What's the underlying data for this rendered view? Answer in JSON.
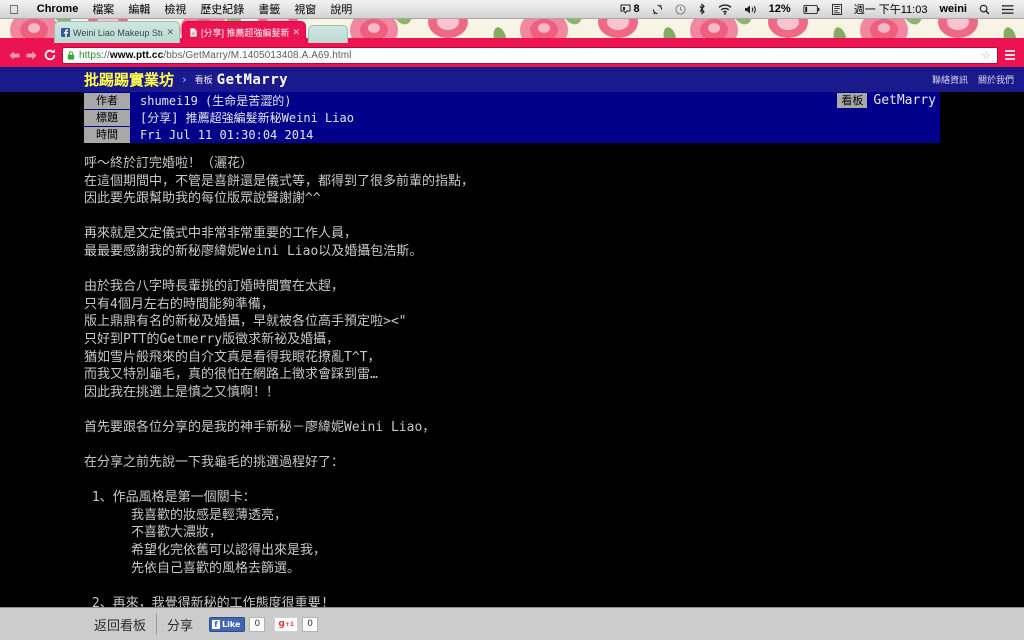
{
  "menubar": {
    "apple_icon": "apple-icon",
    "app_name": "Chrome",
    "items": [
      "檔案",
      "編輯",
      "檢視",
      "歷史紀錄",
      "書籤",
      "視窗",
      "說明"
    ],
    "status": {
      "airplay_label": "8",
      "sync_icon": "sync-arrows-icon",
      "clock_icon": "clock-icon",
      "bluetooth_icon": "bluetooth-icon",
      "wifi_icon": "wifi-icon",
      "volume_icon": "volume-icon",
      "battery_percent": "12%",
      "battery_icon": "battery-icon",
      "input_source_icon": "input-source-icon",
      "datetime": "週一 下午11:03",
      "user": "weini",
      "spotlight_icon": "search-icon",
      "notification_icon": "notification-center-icon"
    }
  },
  "browser": {
    "tabs": [
      {
        "title": "Weini Liao Makeup Studio",
        "favicon": "facebook-icon",
        "active": false
      },
      {
        "title": "[分享] 推薦超強編髮新秘Wei",
        "favicon": "document-icon",
        "active": true
      }
    ],
    "close_glyph": "✕",
    "nav": {
      "back_icon": "back-arrow-icon",
      "forward_icon": "forward-arrow-icon",
      "reload_icon": "reload-icon"
    },
    "omnibox": {
      "lock_icon": "lock-icon",
      "scheme": "https",
      "separator": "://",
      "host": "www.ptt.cc",
      "path": "/bbs/GetMarry/M.1405013408.A.A69.html",
      "full_url": "https://www.ptt.cc/bbs/GetMarry/M.1405013408.A.A69.html"
    },
    "bookmark_icon": "star-icon",
    "menu_icon": "hamburger-menu-icon",
    "window_resize_icon": "fullscreen-icon"
  },
  "ptt": {
    "header": {
      "brand": "批踢踢實業坊",
      "separator": "›",
      "board_label": "看板",
      "board_name": "GetMarry",
      "links": [
        "聯絡資訊",
        "關於我們"
      ]
    },
    "meta": {
      "rows": [
        {
          "label": "作者",
          "value": "shumei19 (生命是苦澀的)"
        },
        {
          "label": "標題",
          "value": "[分享] 推薦超強編髮新秘Weini Liao"
        },
        {
          "label": "時間",
          "value": "Fri Jul 11 01:30:04 2014"
        }
      ],
      "board_tag_label": "看板",
      "board_tag_value": "GetMarry"
    },
    "content": "呼〜終於訂完婚啦！（灑花）\n在這個期間中，不管是喜餅還是儀式等，都得到了很多前輩的指點，\n因此要先跟幫助我的每位版眾說聲謝謝^^\n\n再來就是文定儀式中非常非常重要的工作人員，\n最最要感謝我的新秘廖緯妮Weini Liao以及婚攝包浩斯。\n\n由於我合八字時長輩挑的訂婚時間實在太趕，\n只有4個月左右的時間能夠準備，\n版上鼎鼎有名的新秘及婚攝，早就被各位高手預定啦><\"\n只好到PTT的Getmerry版徵求新祕及婚攝，\n猶如雪片般飛來的自介文真是看得我眼花撩亂T^T，\n而我又特別龜毛，真的很怕在網路上徵求會踩到雷…\n因此我在挑選上是慎之又慎啊！！\n\n首先要跟各位分享的是我的神手新秘－廖緯妮Weini Liao，\n\n在分享之前先說一下我龜毛的挑選過程好了：\n\n 1、作品風格是第一個關卡：\n      我喜歡的妝感是輕薄透亮，\n      不喜歡大濃妝，\n      希望化完依舊可以認得出來是我，\n      先依自己喜歡的風格去篩選。\n\n 2、再來，我覺得新秘的工作態度很重要!",
    "bottom": {
      "back_label": "返回看板",
      "share_label": "分享",
      "fb_like_label": "Like",
      "fb_like_count": "0",
      "gplus_label": "g",
      "gplus_sup": "+1",
      "gplus_count": "0"
    }
  },
  "colors": {
    "chrome_theme": "#eb1352",
    "ptt_header_bg": "#1a1a8c",
    "meta_bg": "#00008b",
    "body_text": "#c8c8c8",
    "brand_yellow": "#ffff4d",
    "bottom_bar": "#cccccc"
  }
}
